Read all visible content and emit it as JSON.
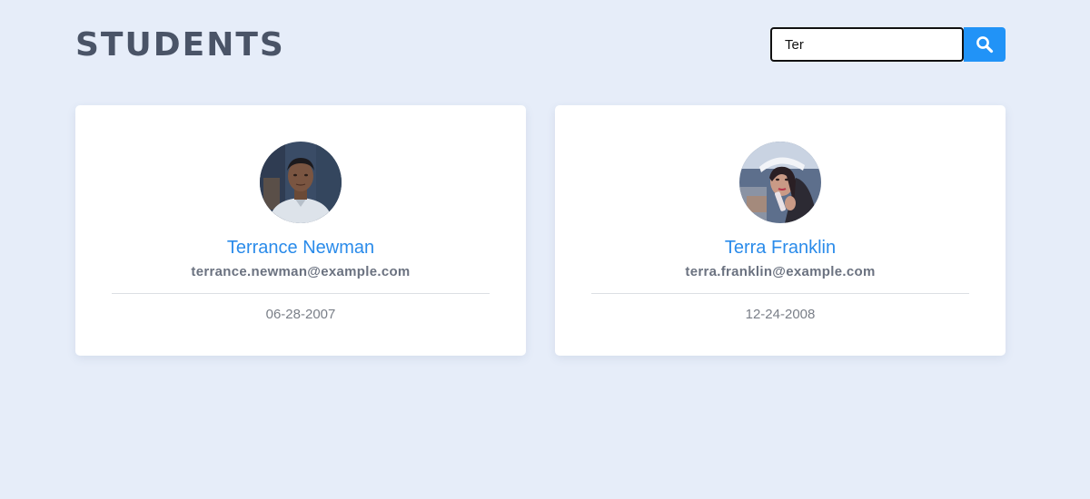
{
  "header": {
    "title": "STUDENTS"
  },
  "search": {
    "value": "Ter",
    "button_icon": "search-icon"
  },
  "colors": {
    "background": "#e6edf9",
    "title": "#4a5467",
    "accent": "#2193f7",
    "name": "#2a8bea",
    "card": "#ffffff"
  },
  "students": [
    {
      "name": "Terrance Newman",
      "email": "terrance.newman@example.com",
      "date": "06-28-2007"
    },
    {
      "name": "Terra Franklin",
      "email": "terra.franklin@example.com",
      "date": "12-24-2008"
    }
  ]
}
